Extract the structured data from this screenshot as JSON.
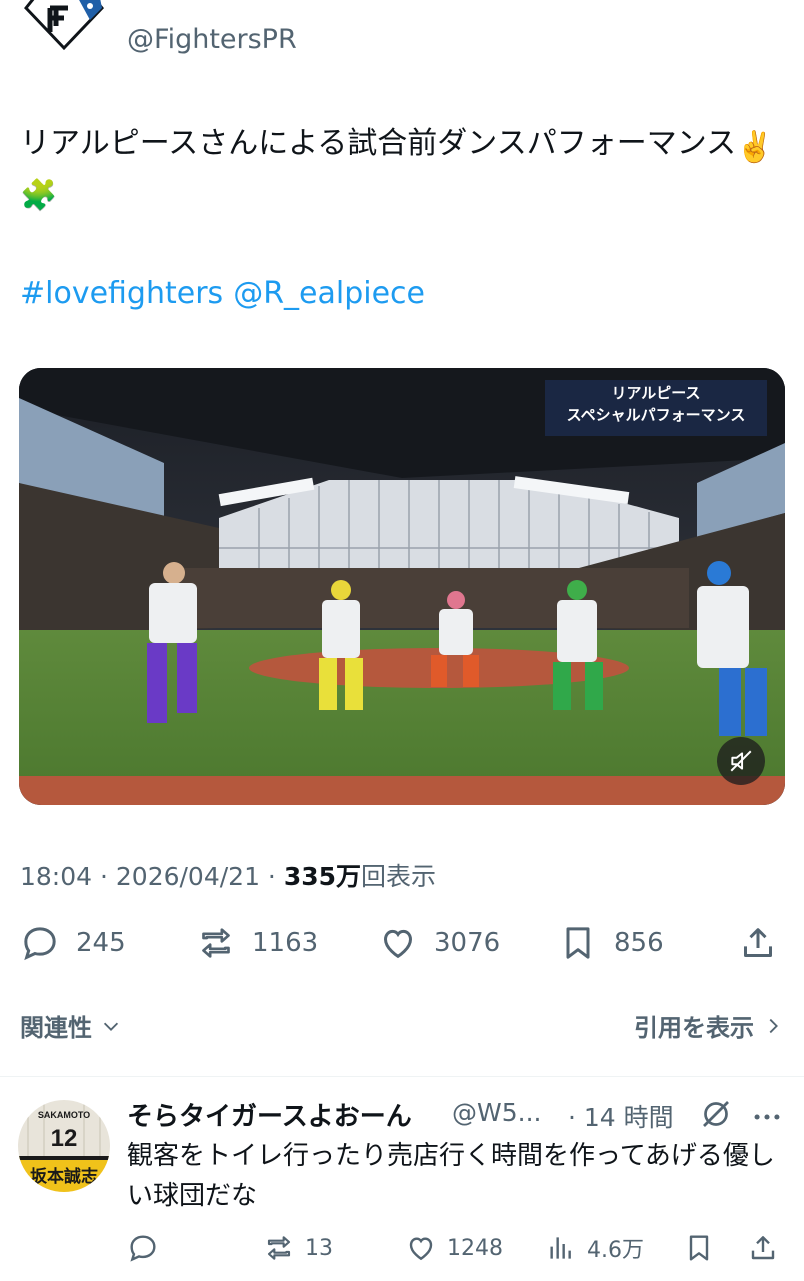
{
  "account": {
    "handle": "@FightersPR"
  },
  "tweet": {
    "text": "リアルピースさんによる試合前ダンスパフォーマンス",
    "emojis": [
      "✌️",
      "🧩"
    ],
    "hashtag": "#lovefighters",
    "mention": "@R_ealpiece"
  },
  "video": {
    "caption_line1": "リアルピース",
    "caption_line2": "スペシャルパフォーマンス",
    "mute_icon": "speaker-muted-icon"
  },
  "meta": {
    "time": "18:04",
    "sep1": " · ",
    "date": "2026/04/21",
    "sep2": " · ",
    "views": "335万",
    "views_label": "回表示"
  },
  "actions": {
    "replies": "245",
    "retweets": "1163",
    "likes": "3076",
    "bookmarks": "856"
  },
  "relevance": {
    "label": "関連性",
    "quotes_link": "引用を表示"
  },
  "reply": {
    "name": "そらタイガースよおーん",
    "handle": "@W5...",
    "time": "· 14 時間",
    "text": "観客をトイレ行ったり売店行く時間を作ってあげる優しい球団だな",
    "avatar_top_text": "SAKAMOTO",
    "avatar_number": "12",
    "avatar_kanji": "坂本誠志",
    "retweets": "13",
    "likes": "1248",
    "views": "4.6万"
  },
  "colors": {
    "link": "#1d9bf0",
    "secondary": "#536471",
    "text": "#0f1419"
  }
}
